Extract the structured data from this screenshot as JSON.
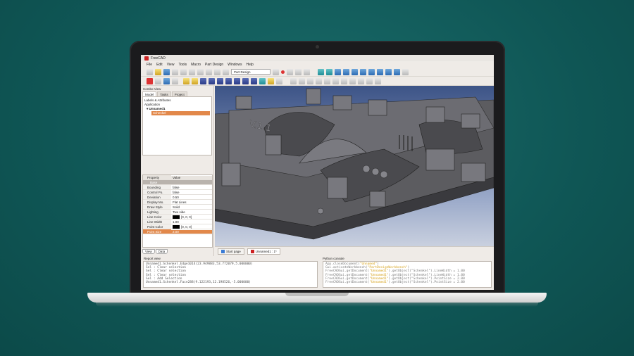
{
  "window": {
    "title": "FreeCAD"
  },
  "menu": [
    "File",
    "Edit",
    "View",
    "Tools",
    "Macro",
    "Part Design",
    "Windows",
    "Help"
  ],
  "workbench": {
    "selected": "Part Design"
  },
  "combo_view": {
    "title": "Combo View",
    "tabs": [
      "Model",
      "Tasks",
      "Project"
    ],
    "tree": {
      "header": "Labels & Attributes",
      "root": "Application",
      "document": "Unnamed1",
      "selected_item": "Schenkel"
    },
    "properties": {
      "columns": [
        "Property",
        "Value"
      ],
      "group": "Base",
      "rows": [
        {
          "name": "Bounding",
          "value": "false"
        },
        {
          "name": "Control Po.",
          "value": "false"
        },
        {
          "name": "Deviation",
          "value": "0.50"
        },
        {
          "name": "Display Mo.",
          "value": "Flat Lines"
        },
        {
          "name": "Draw Style",
          "value": "Solid"
        },
        {
          "name": "Lighting",
          "value": "Two side"
        },
        {
          "name": "Line Color",
          "value": "[0, 0, 0]"
        },
        {
          "name": "Line Width",
          "value": "1.00"
        },
        {
          "name": "Point Color",
          "value": "[0, 0, 0]"
        },
        {
          "name": "Point Size",
          "value": "2.00"
        }
      ],
      "selected_row": "Point Size"
    },
    "bottom_tabs": [
      "View",
      "Data"
    ]
  },
  "viewport": {
    "model_label": "V.1.1"
  },
  "doc_tabs": [
    "Start page",
    "Unnamed1 : 1*"
  ],
  "report_view": {
    "title": "Report view",
    "lines": [
      "Unnamed1.Schenkel.Edge1014(23.949883,53.772079,5.000000)",
      "Sel : Clear selection",
      "Sel : Clear selection",
      "Sel : Clear selection",
      "Sel : Add Selection",
      "Unnamed1.Schenkel.Face288(9.122193,12.198526,-5.000000)"
    ]
  },
  "python_console": {
    "title": "Python console",
    "lines": [
      {
        "pre": "App.closeDocument(",
        "str": "\"Unnamed\"",
        "post": ")"
      },
      {
        "pre": "Gui.activateWorkbench(",
        "str": "\"PartDesignWorkbench\"",
        "post": ")"
      },
      {
        "pre": "FreeCADGui.getDocument(",
        "str": "\"Unnamed1\"",
        "post": ").getObject(\"Schenkel\").LineWidth = 1.00"
      },
      {
        "pre": "FreeCADGui.getDocument(",
        "str": "\"Unnamed1\"",
        "post": ").getObject(\"Schenkel\").LineWidth = 1.00"
      },
      {
        "pre": "FreeCADGui.getDocument(",
        "str": "\"Unnamed1\"",
        "post": ").getObject(\"Schenkel\").PointSize = 2.00"
      },
      {
        "pre": "FreeCADGui.getDocument(",
        "str": "\"Unnamed1\"",
        "post": ").getObject(\"Schenkel\").PointSize = 2.00"
      }
    ]
  }
}
